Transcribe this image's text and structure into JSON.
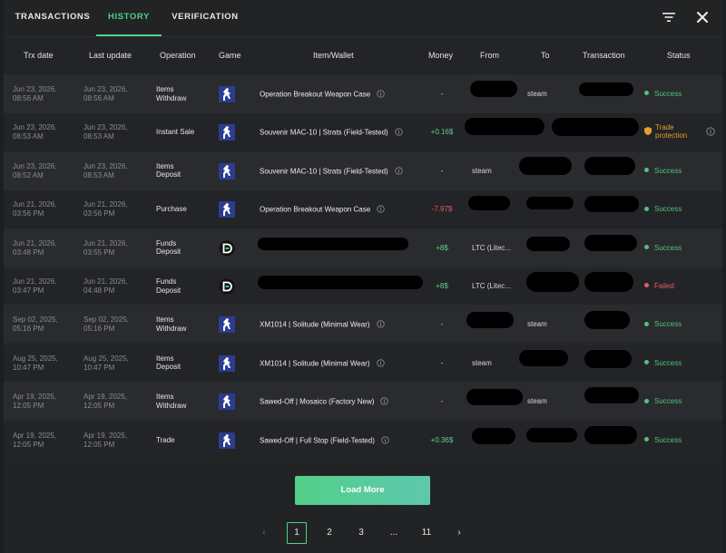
{
  "tabs": [
    {
      "label": "TRANSACTIONS",
      "active": false
    },
    {
      "label": "HISTORY",
      "active": true
    },
    {
      "label": "VERIFICATION",
      "active": false
    }
  ],
  "header_icons": {
    "filter": "filter-icon",
    "close": "close-icon"
  },
  "columns": [
    "Trx date",
    "Last update",
    "Operation",
    "Game",
    "Item/Wallet",
    "Money",
    "From",
    "To",
    "Transaction",
    "Status"
  ],
  "rows": [
    {
      "trx_date": [
        "Jun 23, 2026,",
        "08:56 AM"
      ],
      "last_update": [
        "Jun 23, 2026,",
        "08:56 AM"
      ],
      "operation": [
        "Items",
        "Withdraw"
      ],
      "game": "cs-icon",
      "item": "Operation Breakout Weapon Case",
      "item_info": true,
      "money": "-",
      "money_kind": "none",
      "from": "",
      "to": "steam",
      "status": "Success",
      "status_kind": "success"
    },
    {
      "trx_date": [
        "Jun 23, 2026,",
        "08:53 AM"
      ],
      "last_update": [
        "Jun 23, 2026,",
        "08:53 AM"
      ],
      "operation": [
        "Instant Sale",
        ""
      ],
      "game": "cs-icon",
      "item": "Souvenir MAC-10 | Strats (Field-Tested)",
      "item_info": true,
      "money": "+0.16$",
      "money_kind": "pos",
      "from": "",
      "to": "",
      "status": "Trade protection",
      "status_lines": [
        "Trade",
        "protection"
      ],
      "status_kind": "trade"
    },
    {
      "trx_date": [
        "Jun 23, 2026,",
        "08:52 AM"
      ],
      "last_update": [
        "Jun 23, 2026,",
        "08:53 AM"
      ],
      "operation": [
        "Items",
        "Deposit"
      ],
      "game": "cs-icon",
      "item": "Souvenir MAC-10 | Strats (Field-Tested)",
      "item_info": true,
      "money": "-",
      "money_kind": "none",
      "from": "steam",
      "to": "",
      "status": "Success",
      "status_kind": "success"
    },
    {
      "trx_date": [
        "Jun 21, 2026,",
        "03:56 PM"
      ],
      "last_update": [
        "Jun 21, 2026,",
        "03:56 PM"
      ],
      "operation": [
        "Purchase",
        ""
      ],
      "game": "cs-icon",
      "item": "Operation Breakout Weapon Case",
      "item_info": true,
      "money": "-7.97$",
      "money_kind": "neg",
      "from": "",
      "to": "",
      "status": "Success",
      "status_kind": "success"
    },
    {
      "trx_date": [
        "Jun 21, 2026,",
        "03:48 PM"
      ],
      "last_update": [
        "Jun 21, 2026,",
        "03:55 PM"
      ],
      "operation": [
        "Funds",
        "Deposit"
      ],
      "game": "d-icon",
      "item": "",
      "item_info": false,
      "money": "+8$",
      "money_kind": "pos",
      "from": "LTC (Litec...",
      "to": "",
      "status": "Success",
      "status_kind": "success"
    },
    {
      "trx_date": [
        "Jun 21, 2026,",
        "03:47 PM"
      ],
      "last_update": [
        "Jun 21, 2026,",
        "04:48 PM"
      ],
      "operation": [
        "Funds",
        "Deposit"
      ],
      "game": "d-icon",
      "item": "",
      "item_info": false,
      "money": "+8$",
      "money_kind": "pos",
      "from": "LTC (Litec...",
      "to": "",
      "status": "Failed",
      "status_kind": "failed"
    },
    {
      "trx_date": [
        "Sep 02, 2025,",
        "05:16 PM"
      ],
      "last_update": [
        "Sep 02, 2025,",
        "05:16 PM"
      ],
      "operation": [
        "Items",
        "Withdraw"
      ],
      "game": "cs-icon",
      "item": "XM1014 | Solitude (Minimal Wear)",
      "item_info": true,
      "money": "-",
      "money_kind": "none",
      "from": "",
      "to": "steam",
      "status": "Success",
      "status_kind": "success"
    },
    {
      "trx_date": [
        "Aug 25, 2025,",
        "10:47 PM"
      ],
      "last_update": [
        "Aug 25, 2025,",
        "10:47 PM"
      ],
      "operation": [
        "Items",
        "Deposit"
      ],
      "game": "cs-icon",
      "item": "XM1014 | Solitude (Minimal Wear)",
      "item_info": true,
      "money": "-",
      "money_kind": "none",
      "from": "steam",
      "to": "",
      "status": "Success",
      "status_kind": "success"
    },
    {
      "trx_date": [
        "Apr 19, 2025,",
        "12:05 PM"
      ],
      "last_update": [
        "Apr 19, 2025,",
        "12:05 PM"
      ],
      "operation": [
        "Items",
        "Withdraw"
      ],
      "game": "cs-icon",
      "item": "Sawed-Off | Mosaico (Factory New)",
      "item_info": true,
      "money": "-",
      "money_kind": "none",
      "from": "",
      "to": "steam",
      "status": "Success",
      "status_kind": "success"
    },
    {
      "trx_date": [
        "Apr 19, 2025,",
        "12:05 PM"
      ],
      "last_update": [
        "Apr 19, 2025,",
        "12:05 PM"
      ],
      "operation": [
        "Trade",
        ""
      ],
      "game": "cs-icon",
      "item": "Sawed-Off | Full Stop (Field-Tested)",
      "item_info": true,
      "money": "+0.36$",
      "money_kind": "pos",
      "from": "",
      "to": "",
      "status": "Success",
      "status_kind": "success"
    }
  ],
  "load_more_label": "Load More",
  "pagination": {
    "prev": "‹",
    "pages": [
      "1",
      "2",
      "3",
      "...",
      "11"
    ],
    "current": "1",
    "next": "›"
  },
  "colors": {
    "accent": "#52d08a",
    "negative": "#e0605d",
    "warning": "#e3a02a",
    "background": "#222325"
  }
}
